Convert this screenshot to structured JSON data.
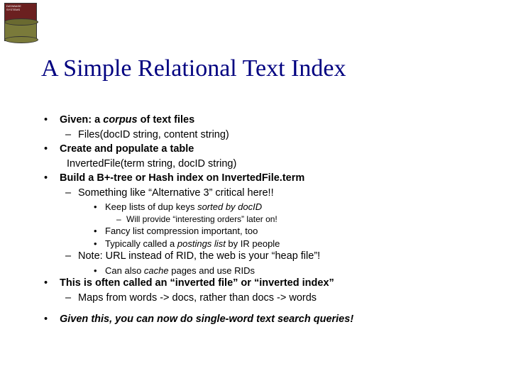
{
  "title": "A Simple Relational Text Index",
  "bullets": {
    "given_pre": "Given: a ",
    "given_em": "corpus",
    "given_post": " of text files",
    "files_schema": "Files(docID string, content string)",
    "create_table": "Create and populate a table",
    "inverted_schema": "InvertedFile(term string, docID string)",
    "btree": "Build a B+-tree or Hash index on InvertedFile.term",
    "alt3": "Something like “Alternative 3” critical here!!",
    "dup_pre": "Keep lists of dup keys ",
    "dup_em": "sorted by docID",
    "orders": "Will provide “interesting orders” later on!",
    "fancy": "Fancy list compression important, too",
    "postings_pre": "Typically called a ",
    "postings_em": "postings list",
    "postings_post": " by IR people",
    "url_note": "Note: URL instead of RID, the web is your “heap file”!",
    "cache_pre": "Can also ",
    "cache_em": "cache",
    "cache_post": " pages and use RIDs",
    "inverted_index": "This is often called an “inverted file” or “inverted index”",
    "maps": "Maps from words -> docs, rather than docs -> words",
    "conclusion": "Given this, you can now do single-word text search queries!"
  }
}
